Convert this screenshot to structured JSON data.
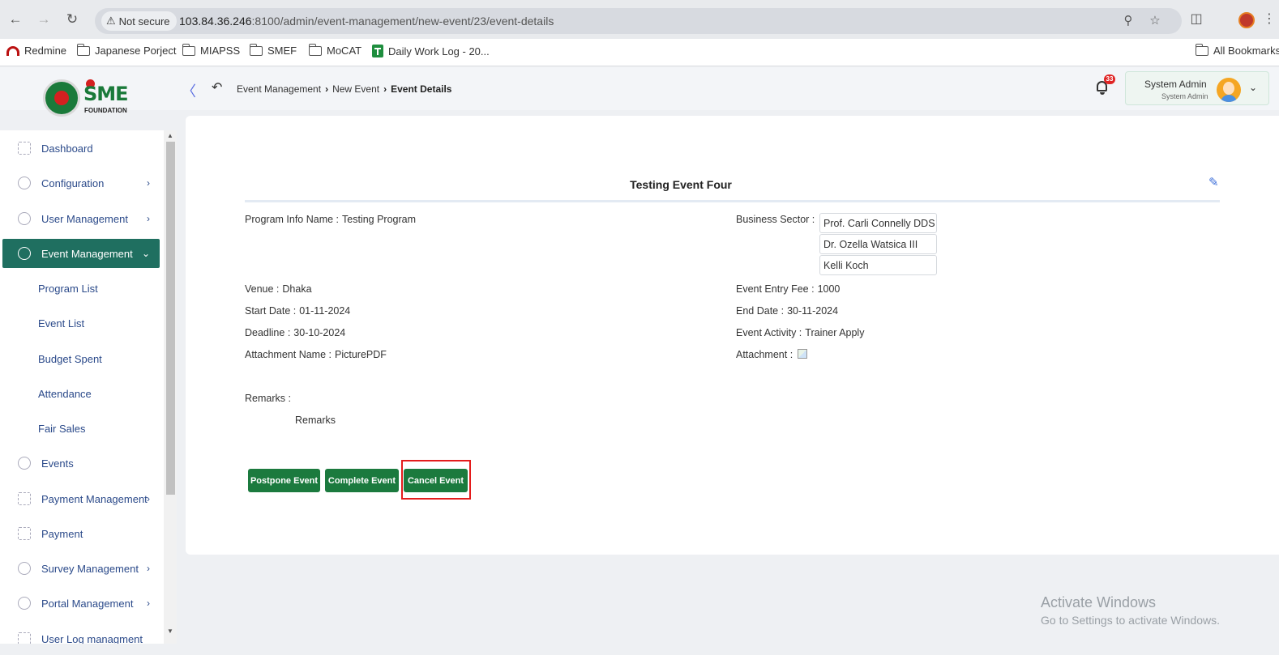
{
  "browser": {
    "security_label": "Not secure",
    "url_host": "103.84.36.246",
    "url_path": ":8100/admin/event-management/new-event/23/event-details",
    "bookmarks": [
      "Redmine",
      "Japanese Porject",
      "MIAPSS",
      "SMEF",
      "MoCAT",
      "Daily Work Log - 20...",
      "All Bookmarks"
    ]
  },
  "logo": {
    "text": "SME",
    "subtitle": "FOUNDATION"
  },
  "breadcrumb": {
    "items": [
      "Event Management",
      "New Event",
      "Event Details"
    ]
  },
  "header": {
    "notification_count": "33",
    "user_name": "System Admin",
    "user_role": "System Admin"
  },
  "sidebar": {
    "items": [
      {
        "label": "Dashboard",
        "icon": "dashboard-icon"
      },
      {
        "label": "Configuration",
        "icon": "gear-icon"
      },
      {
        "label": "User Management",
        "icon": "shield-icon"
      },
      {
        "label": "Event Management",
        "icon": "lock-icon"
      },
      {
        "label": "Events",
        "icon": "lock-icon"
      },
      {
        "label": "Payment Management",
        "icon": "money-icon"
      },
      {
        "label": "Payment",
        "icon": "money-icon"
      },
      {
        "label": "Survey Management",
        "icon": "pie-chart-icon"
      },
      {
        "label": "Portal Management",
        "icon": "lock-icon"
      },
      {
        "label": "User Log managment",
        "icon": "log-icon"
      }
    ],
    "sub_items": [
      "Program List",
      "Event List",
      "Budget Spent",
      "Attendance",
      "Fair Sales"
    ],
    "active_color": "#1f6f60"
  },
  "event": {
    "title": "Testing Event Four",
    "program_info_label": "Program Info Name :",
    "program_info_value": "Testing Program",
    "business_sector_label": "Business Sector :",
    "business_sectors": [
      "Prof. Carli Connelly DDS",
      "Dr. Ozella Watsica III",
      "Kelli Koch"
    ],
    "venue_label": "Venue :",
    "venue_value": "Dhaka",
    "entry_fee_label": "Event Entry Fee :",
    "entry_fee_value": "1000",
    "start_date_label": "Start Date :",
    "start_date_value": "01-11-2024",
    "end_date_label": "End Date :",
    "end_date_value": "30-11-2024",
    "deadline_label": "Deadline :",
    "deadline_value": "30-10-2024",
    "activity_label": "Event Activity :",
    "activity_value": "Trainer Apply",
    "attachment_name_label": "Attachment Name :",
    "attachment_name_value": "PicturePDF",
    "attachment_label": "Attachment :",
    "remarks_label": "Remarks :",
    "remarks_value": "Remarks"
  },
  "actions": {
    "postpone": "Postpone Event",
    "complete": "Complete Event",
    "cancel": "Cancel Event",
    "button_color": "#1b7a3e"
  },
  "watermark": {
    "line1": "Activate Windows",
    "line2": "Go to Settings to activate Windows."
  }
}
